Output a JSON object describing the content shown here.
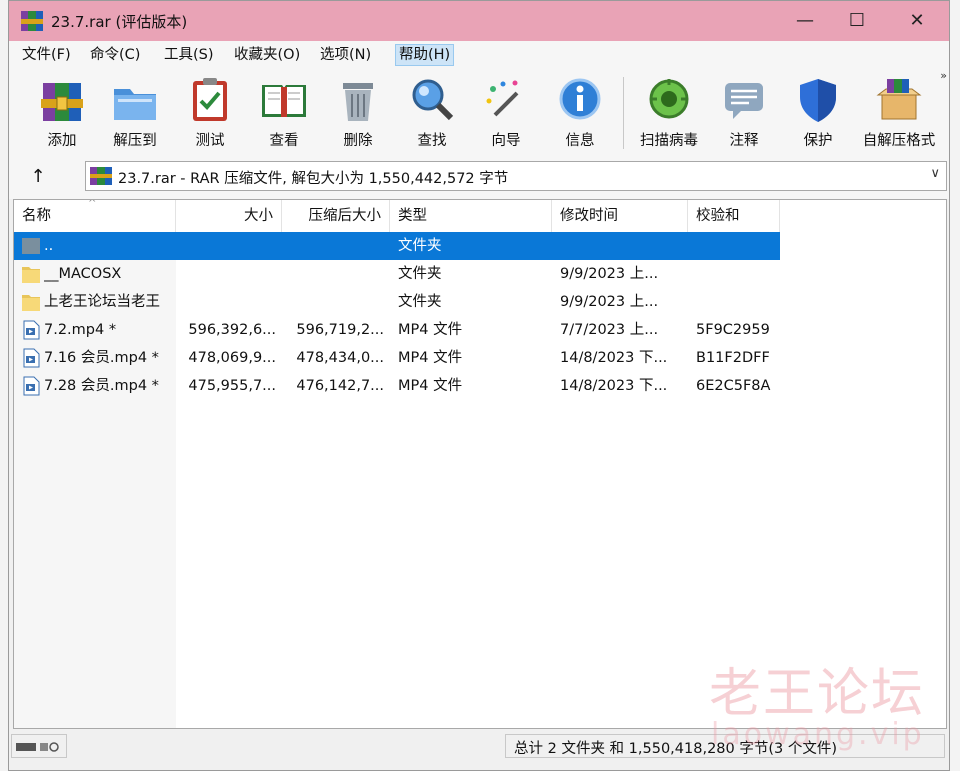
{
  "window": {
    "title": "23.7.rar (评估版本)",
    "minimize": "—",
    "maximize": "☐",
    "close": "✕"
  },
  "menu": [
    "文件(F)",
    "命令(C)",
    "工具(S)",
    "收藏夹(O)",
    "选项(N)",
    "帮助(H)"
  ],
  "toolbar": [
    {
      "label": "添加",
      "icon": "add-archive-icon"
    },
    {
      "label": "解压到",
      "icon": "extract-folder-icon"
    },
    {
      "label": "测试",
      "icon": "test-clipboard-icon"
    },
    {
      "label": "查看",
      "icon": "view-book-icon"
    },
    {
      "label": "删除",
      "icon": "trash-icon"
    },
    {
      "label": "查找",
      "icon": "magnifier-icon"
    },
    {
      "label": "向导",
      "icon": "wizard-wand-icon"
    },
    {
      "label": "信息",
      "icon": "info-icon"
    },
    {
      "label": "扫描病毒",
      "icon": "virus-scan-icon"
    },
    {
      "label": "注释",
      "icon": "comment-icon"
    },
    {
      "label": "保护",
      "icon": "shield-icon"
    },
    {
      "label": "自解压格式",
      "icon": "sfx-box-icon"
    }
  ],
  "toolbar_more": "»",
  "address": {
    "up": "↑",
    "text": "23.7.rar - RAR 压缩文件, 解包大小为 1,550,442,572 字节",
    "dropdown": "∨"
  },
  "columns": [
    "名称",
    "大小",
    "压缩后大小",
    "类型",
    "修改时间",
    "校验和"
  ],
  "sort_indicator": "^",
  "rows": [
    {
      "name": "..",
      "size": "",
      "packed": "",
      "type": "文件夹",
      "modified": "",
      "crc": "",
      "icon": "parent-folder-icon",
      "selected": true
    },
    {
      "name": "__MACOSX",
      "size": "",
      "packed": "",
      "type": "文件夹",
      "modified": "9/9/2023 上...",
      "crc": "",
      "icon": "folder-icon",
      "selected": false
    },
    {
      "name": "上老王论坛当老王",
      "size": "",
      "packed": "",
      "type": "文件夹",
      "modified": "9/9/2023 上...",
      "crc": "",
      "icon": "folder-icon",
      "selected": false
    },
    {
      "name": "7.2.mp4 *",
      "size": "596,392,6...",
      "packed": "596,719,2...",
      "type": "MP4 文件",
      "modified": "7/7/2023 上...",
      "crc": "5F9C2959",
      "icon": "video-file-icon",
      "selected": false
    },
    {
      "name": "7.16 会员.mp4 *",
      "size": "478,069,9...",
      "packed": "478,434,0...",
      "type": "MP4 文件",
      "modified": "14/8/2023 下...",
      "crc": "B11F2DFF",
      "icon": "video-file-icon",
      "selected": false
    },
    {
      "name": "7.28 会员.mp4 *",
      "size": "475,955,7...",
      "packed": "476,142,7...",
      "type": "MP4 文件",
      "modified": "14/8/2023 下...",
      "crc": "6E2C5F8A",
      "icon": "video-file-icon",
      "selected": false
    }
  ],
  "status": {
    "summary": "总计 2 文件夹 和 1,550,418,280 字节(3 个文件)"
  },
  "watermark": {
    "text": "老王论坛",
    "url": "laowang.vip"
  },
  "colors": {
    "titlebar": "#e9a3b6",
    "selection": "#0a78d7"
  }
}
